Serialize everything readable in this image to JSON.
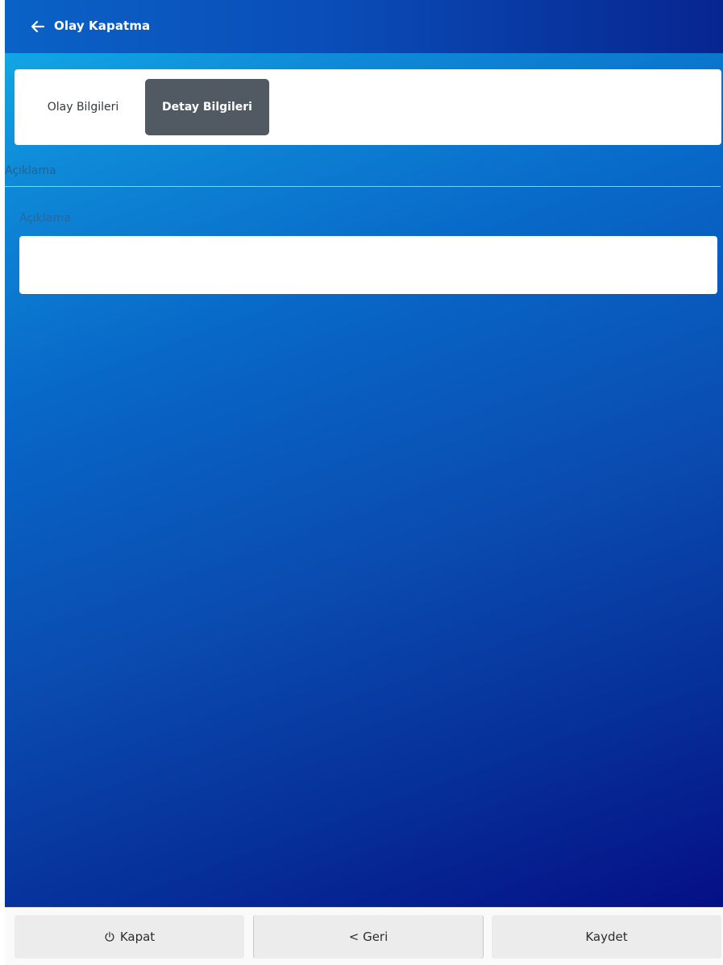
{
  "header": {
    "title": "Olay Kapatma",
    "back_icon": "arrow-left-icon"
  },
  "tabs": [
    {
      "label": "Olay Bilgileri",
      "active": false
    },
    {
      "label": "Detay Bilgileri",
      "active": true
    }
  ],
  "section": {
    "label": "Açıklama"
  },
  "form": {
    "description_label": "Açıklama",
    "description_value": ""
  },
  "footer": {
    "close_label": "Kapat",
    "close_icon": "power-icon",
    "back_label": "< Geri",
    "save_label": "Kaydet"
  },
  "colors": {
    "header_start": "#0a62c6",
    "header_end": "#07258f",
    "background_top": "#12b3ea",
    "background_bottom": "#050f86",
    "active_tab": "#515962"
  }
}
